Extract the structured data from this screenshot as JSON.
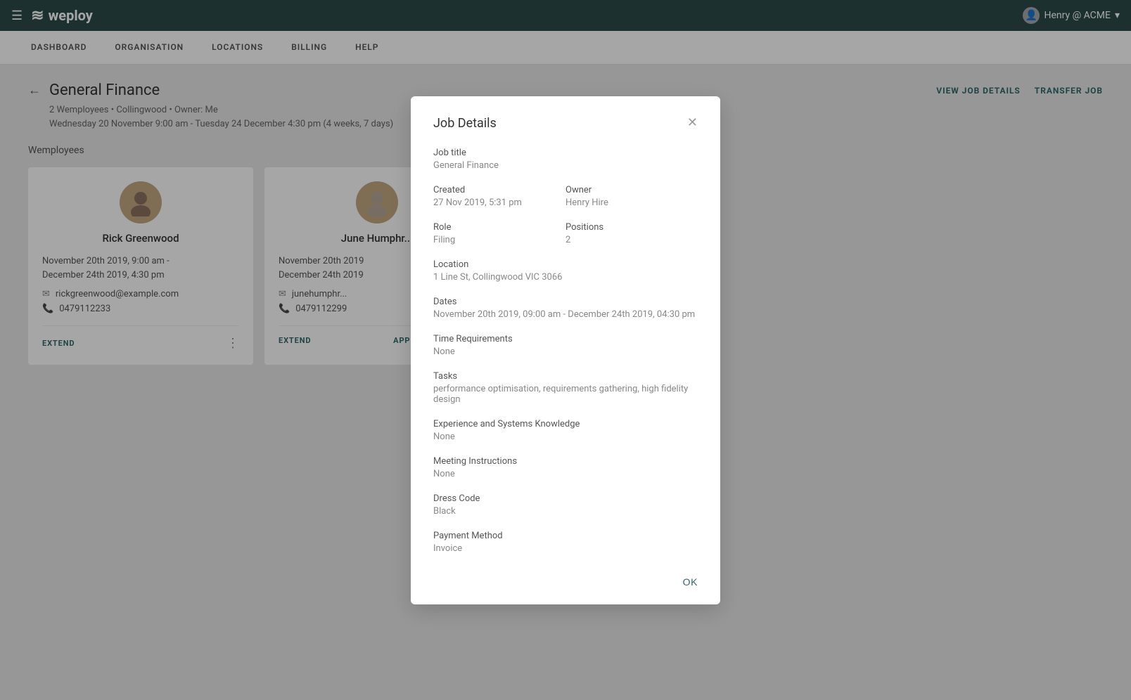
{
  "app": {
    "name": "weploy",
    "logo_symbol": "≋"
  },
  "user": {
    "label": "Henry @ ACME",
    "icon": "account-circle"
  },
  "nav": {
    "items": [
      {
        "id": "dashboard",
        "label": "Dashboard"
      },
      {
        "id": "organisation",
        "label": "Organisation"
      },
      {
        "id": "locations",
        "label": "Locations"
      },
      {
        "id": "billing",
        "label": "Billing"
      },
      {
        "id": "help",
        "label": "Help"
      }
    ]
  },
  "page": {
    "title": "General Finance",
    "meta_line1": "2 Wemployees • Collingwood • Owner: Me",
    "meta_line2": "Wednesday 20 November 9:00 am - Tuesday 24 December 4:30 pm (4 weeks, 7 days)",
    "back_label": "←",
    "action_view": "View Job Details",
    "action_transfer": "Transfer Job",
    "section_label": "Wemployees"
  },
  "workers": [
    {
      "name": "Rick Greenwood",
      "dates_line1": "November 20th 2019, 9:00 am -",
      "dates_line2": "December 24th 2019, 4:30 pm",
      "email": "rickgreenwood@example.com",
      "phone": "0479112233",
      "action": "Extend",
      "more": "⋮"
    },
    {
      "name": "June Humphr...",
      "dates_line1": "November 20th 2019",
      "dates_line2": "December 24th 2019",
      "email": "junehumphr...",
      "phone": "0479112299",
      "action_extend": "Extend",
      "action_approve": "Approve Timesh...",
      "more": ""
    }
  ],
  "modal": {
    "title": "Job Details",
    "close_label": "✕",
    "fields": {
      "job_title_label": "Job title",
      "job_title_value": "General Finance",
      "created_label": "Created",
      "created_value": "27 Nov 2019, 5:31 pm",
      "owner_label": "Owner",
      "owner_value": "Henry Hire",
      "role_label": "Role",
      "role_value": "Filing",
      "positions_label": "Positions",
      "positions_value": "2",
      "location_label": "Location",
      "location_value": "1 Line St, Collingwood VIC 3066",
      "dates_label": "Dates",
      "dates_value": "November 20th 2019, 09:00 am - December 24th 2019, 04:30 pm",
      "time_req_label": "Time Requirements",
      "time_req_value": "None",
      "tasks_label": "Tasks",
      "tasks_value": "performance optimisation, requirements gathering, high fidelity design",
      "exp_label": "Experience and Systems Knowledge",
      "exp_value": "None",
      "meeting_label": "Meeting Instructions",
      "meeting_value": "None",
      "dress_label": "Dress Code",
      "dress_value": "Black",
      "payment_label": "Payment Method",
      "payment_value": "Invoice"
    },
    "ok_label": "OK"
  }
}
